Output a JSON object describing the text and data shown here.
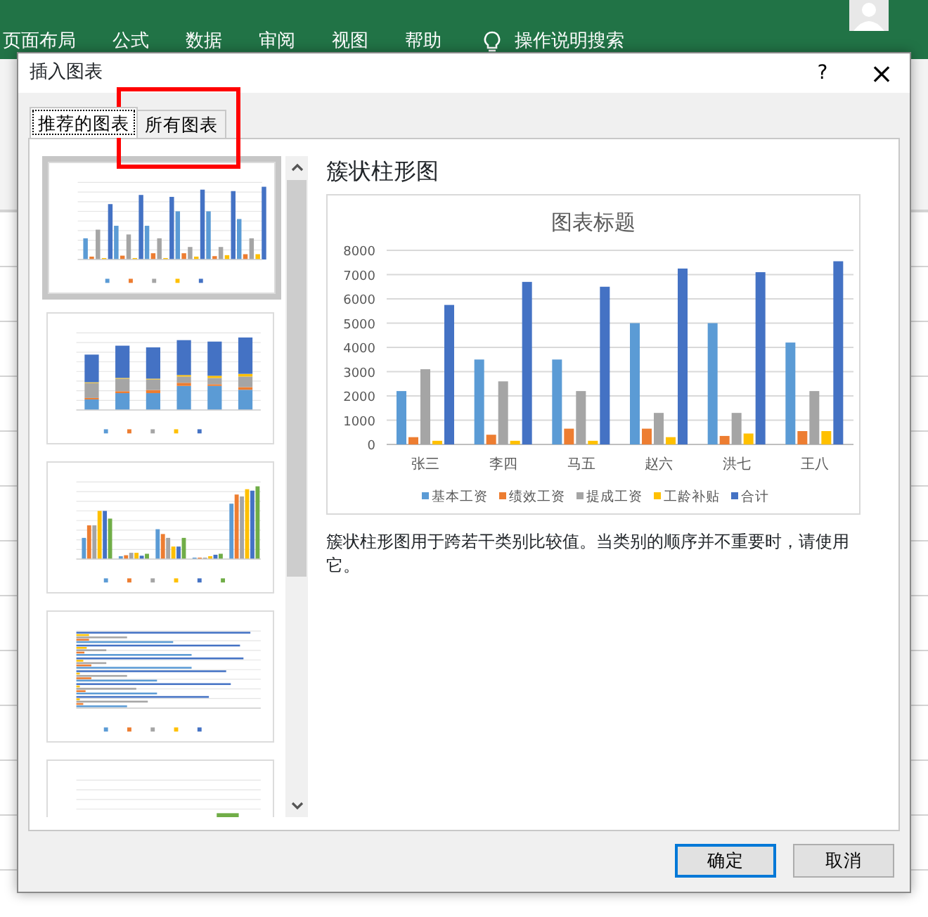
{
  "ribbon": {
    "tabs": [
      "页面布局",
      "公式",
      "数据",
      "审阅",
      "视图",
      "帮助"
    ],
    "search": "操作说明搜索"
  },
  "dialog": {
    "title": "插入图表",
    "help": "?",
    "close": "×",
    "tabs": [
      {
        "label": "推荐的图表",
        "selected": true
      },
      {
        "label": "所有图表",
        "selected": false
      }
    ],
    "thumbnails": [
      {
        "kind": "clustered",
        "selected": true
      },
      {
        "kind": "stacked",
        "selected": false
      },
      {
        "kind": "by-series",
        "selected": false
      },
      {
        "kind": "horizontal",
        "selected": false
      },
      {
        "kind": "stacked-total",
        "selected": false
      }
    ],
    "preview": {
      "heading": "簇状柱形图",
      "chart_data": {
        "type": "bar",
        "title": "图表标题",
        "categories": [
          "张三",
          "李四",
          "马五",
          "赵六",
          "洪七",
          "王八"
        ],
        "series": [
          {
            "name": "基本工资",
            "color": "#5b9bd5",
            "values": [
              2200,
              3500,
              3500,
              5000,
              5000,
              4200
            ]
          },
          {
            "name": "绩效工资",
            "color": "#ed7d31",
            "values": [
              300,
              400,
              650,
              650,
              350,
              550
            ]
          },
          {
            "name": "提成工资",
            "color": "#a5a5a5",
            "values": [
              3100,
              2600,
              2200,
              1300,
              1300,
              2200
            ]
          },
          {
            "name": "工龄补贴",
            "color": "#ffc000",
            "values": [
              150,
              150,
              150,
              300,
              450,
              550
            ]
          },
          {
            "name": "合计",
            "color": "#4472c4",
            "values": [
              5750,
              6700,
              6500,
              7250,
              7100,
              7550
            ]
          }
        ],
        "ylim": [
          0,
          8000
        ],
        "grid": true,
        "legend": "bottom",
        "yticks": [
          0,
          1000,
          2000,
          3000,
          4000,
          5000,
          6000,
          7000,
          8000
        ]
      },
      "description": "簇状柱形图用于跨若干类别比较值。当类别的顺序并不重要时，请使用它。"
    },
    "buttons": [
      {
        "label": "确定",
        "kind": "default"
      },
      {
        "label": "取消",
        "kind": "normal"
      }
    ]
  }
}
